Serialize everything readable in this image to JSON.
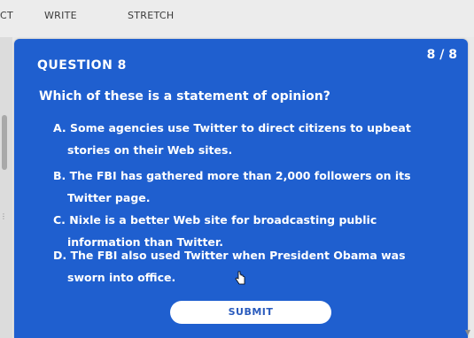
{
  "nav": {
    "item_partial": "CT",
    "write": "WRITE",
    "stretch": "STRETCH"
  },
  "question": {
    "label": "QUESTION 8",
    "progress": "8 / 8",
    "prompt": "Which of these is a statement of opinion?"
  },
  "choices": [
    {
      "line1": "A. Some agencies use Twitter to direct citizens to upbeat",
      "line2": "stories on their Web sites."
    },
    {
      "line1": "B. The FBI has gathered more than 2,000 followers on its",
      "line2": "Twitter page."
    },
    {
      "line1": "C. Nixle is a better Web site for broadcasting public",
      "line2": "information than Twitter."
    },
    {
      "line1": "D. The FBI also used Twitter when President Obama was",
      "line2": "sworn into office."
    }
  ],
  "submit_label": "SUBMIT",
  "colors": {
    "card": "#1f5fcf",
    "submit_text": "#2a5bbd"
  }
}
